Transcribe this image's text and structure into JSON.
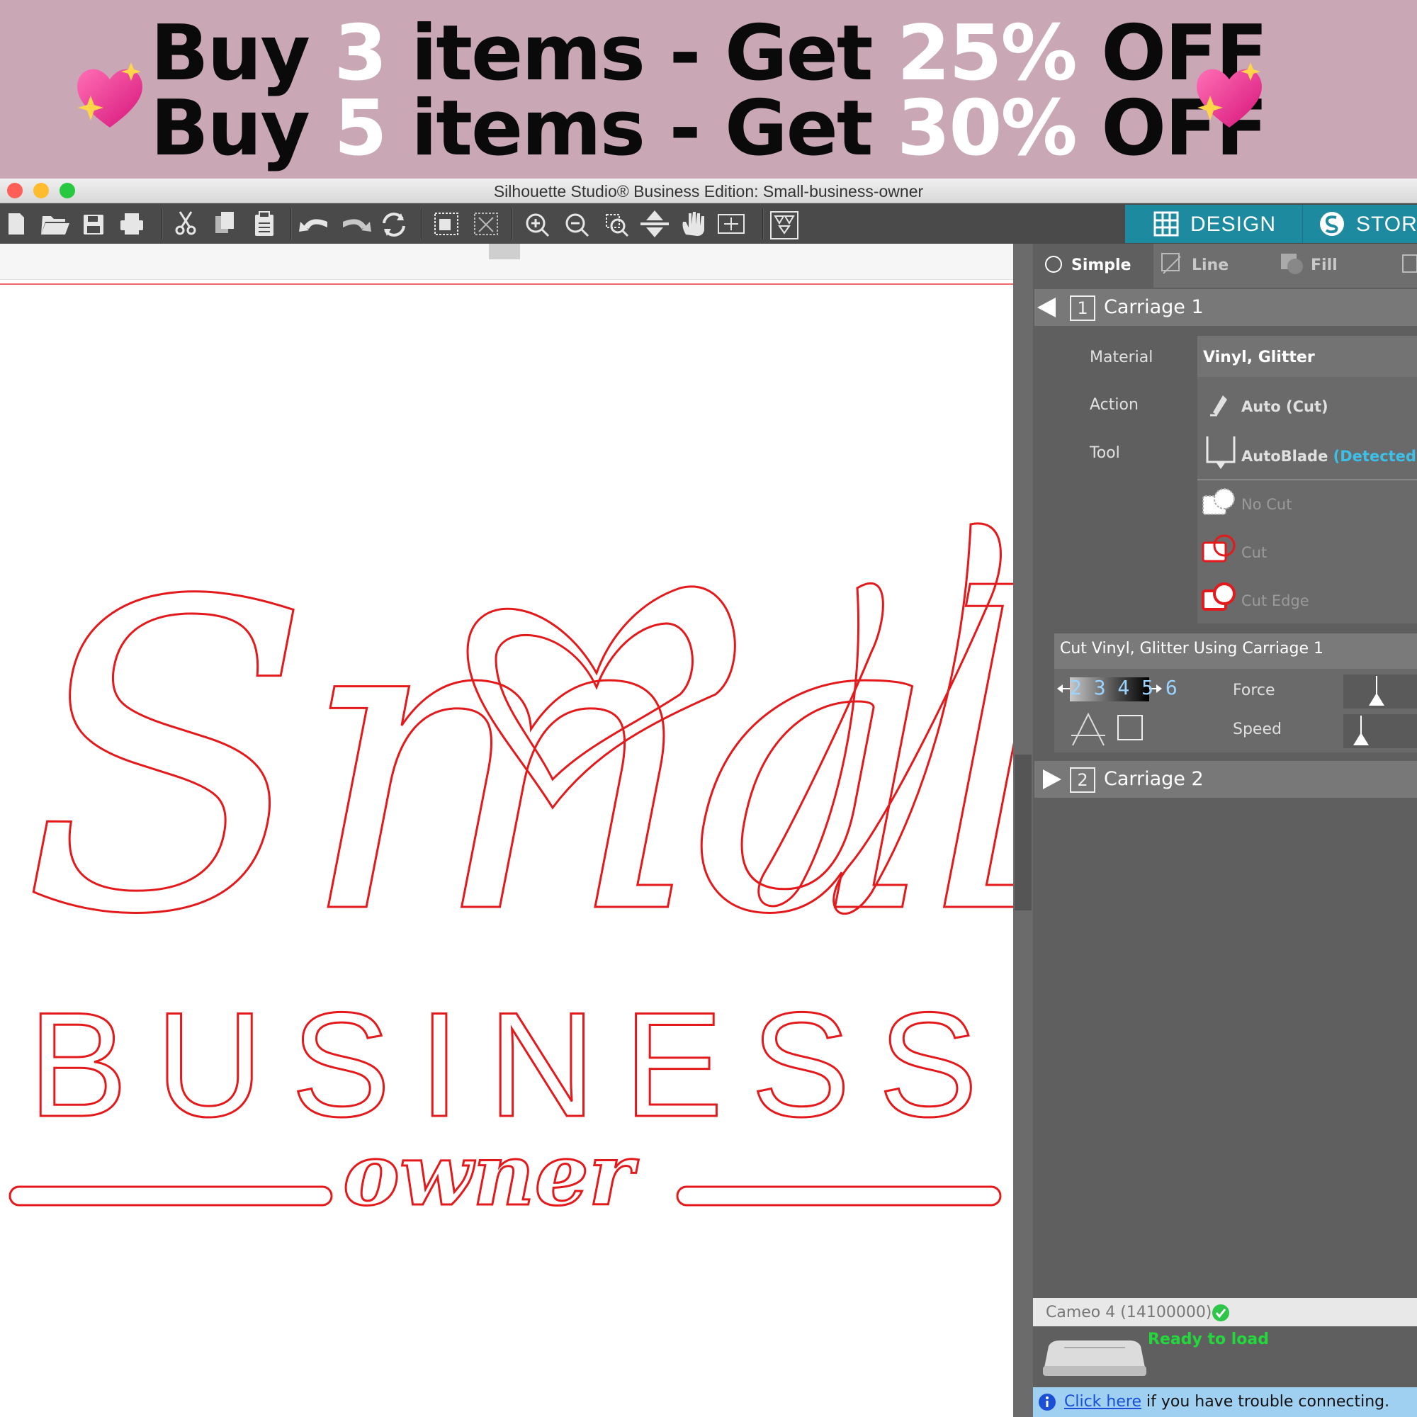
{
  "banner": {
    "line1": {
      "pre": "Buy ",
      "qty": "3",
      "mid": " items - Get ",
      "pct": "25%",
      "post": " OFF"
    },
    "line2": {
      "pre": "Buy ",
      "qty": "5",
      "mid": " items -  Get ",
      "pct": "30%",
      "post": " OFF"
    },
    "heart_icon": "sparkling-heart-icon"
  },
  "window": {
    "title": "Silhouette Studio® Business Edition: Small-business-owner",
    "lights": {
      "close": "#ff5f57",
      "minimize": "#febc2e",
      "zoom": "#28c840"
    }
  },
  "toolbar": {
    "icons": [
      "new-document-icon",
      "open-folder-icon",
      "save-icon",
      "print-icon",
      "cut-scissors-icon",
      "copy-icon",
      "paste-icon",
      "undo-icon",
      "redo-icon",
      "refresh-icon",
      "group-icon",
      "ungroup-icon",
      "zoom-in-icon",
      "zoom-out-icon",
      "zoom-selection-icon",
      "fit-to-page-icon",
      "pan-hand-icon",
      "zoom-fit-icon",
      "trace-icon"
    ],
    "design_label": "DESIGN",
    "store_label": "STORE",
    "accent": "#1d8aa0"
  },
  "canvas": {
    "design_text": {
      "word1": "Small",
      "word2": "BUSINESS",
      "word3": "owner"
    },
    "cut_color": "#e3191b"
  },
  "panel": {
    "modes": {
      "simple": "Simple",
      "line": "Line",
      "fill": "Fill"
    },
    "carriage1": {
      "number": "1",
      "label": "Carriage 1"
    },
    "carriage2": {
      "number": "2",
      "label": "Carriage 2"
    },
    "material_label": "Material",
    "material_value": "Vinyl, Glitter",
    "action_label": "Action",
    "action_value": "Auto (Cut)",
    "tool_label": "Tool",
    "tool_value": "AutoBlade",
    "tool_status": "(Detected)",
    "line_options": [
      "No Cut",
      "Cut",
      "Cut Edge"
    ],
    "cut_header": "Cut Vinyl, Glitter Using Carriage 1",
    "blade_digits": "2 3 4 5 6",
    "force_label": "Force",
    "speed_label": "Speed",
    "device": "Cameo 4 (14100000)",
    "device_status": "Ready to load",
    "help_link": "Click here",
    "help_text": " if you have trouble connecting.",
    "status_color": "#22d83a",
    "detected_color": "#3cc0e8"
  }
}
